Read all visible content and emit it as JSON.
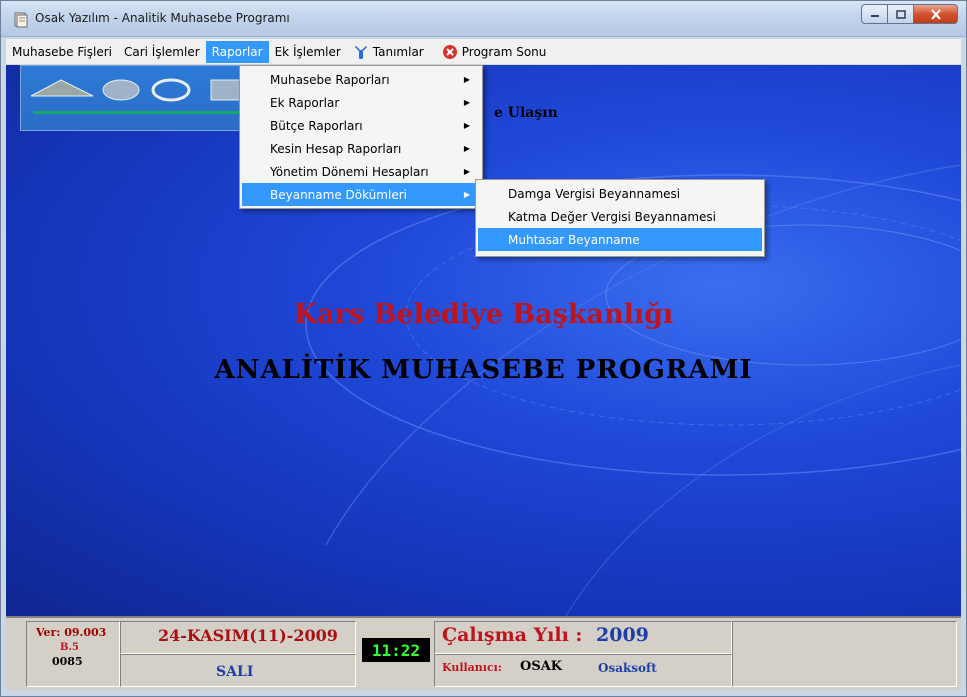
{
  "window": {
    "title": "Osak Yazılım - Analitik Muhasebe Programı",
    "icon": "app-icon"
  },
  "menubar": {
    "items": [
      {
        "label": "Muhasebe Fişleri"
      },
      {
        "label": "Cari İşlemler"
      },
      {
        "label": "Raporlar",
        "active": true
      },
      {
        "label": "Ek İşlemler"
      },
      {
        "label": "Tanımlar",
        "icon": "tools-icon"
      },
      {
        "label": "Program Sonu",
        "icon": "close-circle-icon"
      }
    ]
  },
  "raporlar_menu": {
    "items": [
      {
        "label": "Muhasebe Raporları"
      },
      {
        "label": "Ek Raporlar"
      },
      {
        "label": "Bütçe Raporları"
      },
      {
        "label": "Kesin Hesap Raporları"
      },
      {
        "label": "Yönetim Dönemi Hesapları"
      },
      {
        "label": "Beyanname Dökümleri",
        "highlighted": true
      }
    ]
  },
  "beyanname_menu": {
    "items": [
      {
        "label": "Damga Vergisi Beyannamesi"
      },
      {
        "label": "Katma Değer Vergisi Beyannamesi"
      },
      {
        "label": "Muhtasar Beyanname",
        "highlighted": true
      }
    ]
  },
  "main": {
    "reach_text": "e Ulaşın",
    "org_title": "Kars Belediye Başkanlığı",
    "app_title": "ANALİTİK MUHASEBE PROGRAMI"
  },
  "status": {
    "version_label": "Ver: 09.003",
    "build": "B.5",
    "code": "0085",
    "date": "24-KASIM(11)-2009",
    "day": "SALI",
    "time": "11:22",
    "year_label": "Çalışma Yılı :",
    "year": "2009",
    "user_label": "Kullanıcı:",
    "user": "OSAK",
    "company": "Osaksoft"
  },
  "colors": {
    "menu_highlight": "#3399ff",
    "client_bg": "#1f48d8",
    "title_red": "#c0141c",
    "status_blue": "#1c3fa8",
    "clock_green": "#33ff33"
  }
}
